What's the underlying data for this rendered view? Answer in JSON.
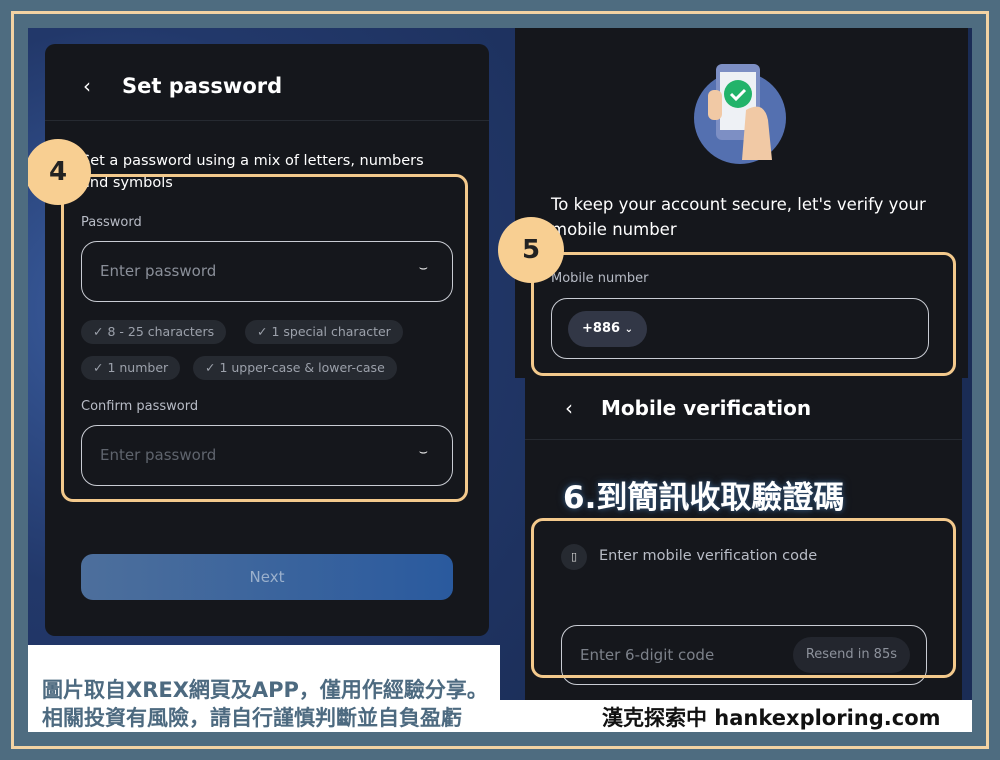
{
  "set_password": {
    "title": "Set password",
    "intro": "Set a password using a mix of letters, numbers and symbols",
    "password_label": "Password",
    "password_placeholder": "Enter password",
    "requirements": [
      "8 - 25 characters",
      "1 special character",
      "1 number",
      "1 upper-case & lower-case"
    ],
    "confirm_label": "Confirm password",
    "confirm_placeholder": "Enter password",
    "next_label": "Next",
    "step": "4"
  },
  "mobile": {
    "intro": "To keep your account secure, let's verify your mobile number",
    "label": "Mobile number",
    "country_code": "+886",
    "step": "5"
  },
  "verification": {
    "title": "Mobile verification",
    "overlay_text": "6.到簡訊收取驗證碼",
    "prompt": "Enter mobile verification code",
    "code_placeholder": "Enter 6-digit code",
    "resend_label": "Resend in 85s"
  },
  "caption": {
    "line1": "圖片取自XREX網頁及APP，僅用作經驗分享。",
    "line2": "相關投資有風險，請自行謹慎判斷並自負盈虧",
    "site": "漢克探索中 hankexploring.com"
  },
  "colors": {
    "highlight": "#f3c98c",
    "badge": "#f8cf92",
    "button": "#2c5a9a",
    "frame": "#4e6c80"
  }
}
